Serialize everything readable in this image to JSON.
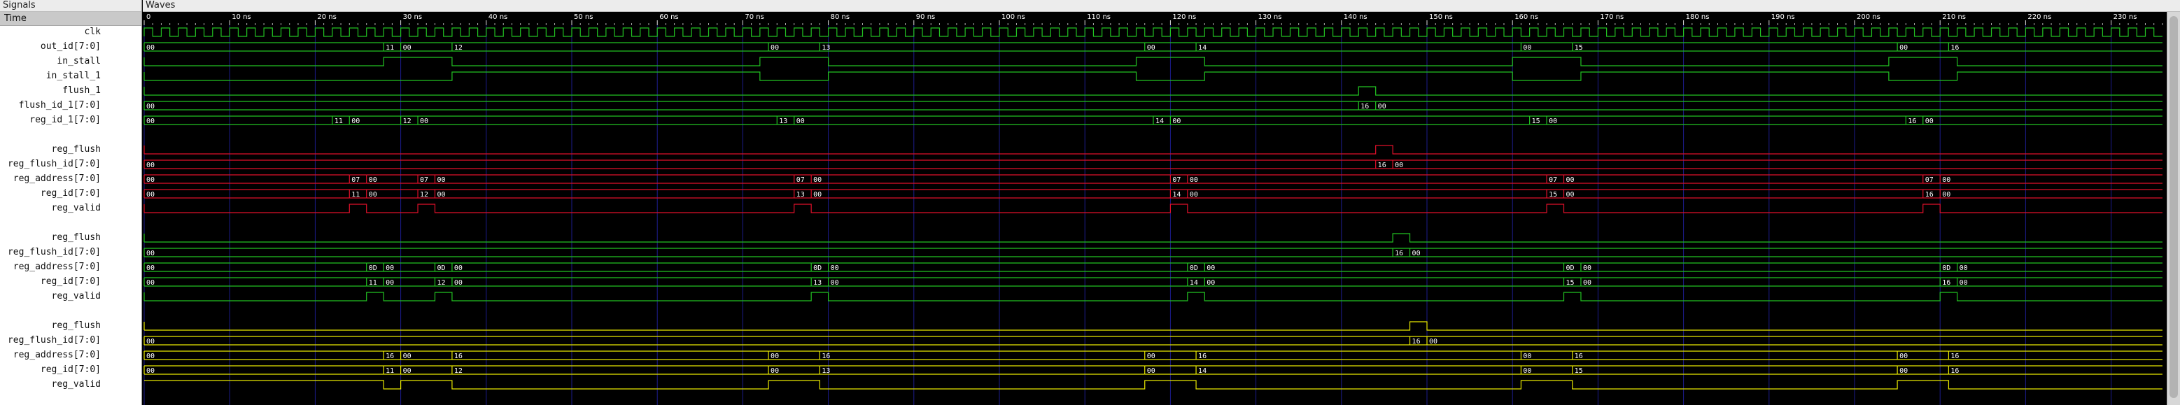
{
  "panes": {
    "signals_title": "Signals",
    "waves_title": "Waves"
  },
  "signal_header": "Time",
  "time_axis": {
    "unit": "ns",
    "min": 0,
    "max": 236,
    "ticks": [
      0,
      10,
      20,
      30,
      40,
      50,
      60,
      70,
      80,
      90,
      100,
      110,
      120,
      130,
      140,
      150,
      160,
      170,
      180,
      190,
      200,
      210,
      220,
      230
    ],
    "tick_labels": [
      "0",
      "10 ns",
      "20 ns",
      "30 ns",
      "40 ns",
      "50 ns",
      "60 ns",
      "70 ns",
      "80 ns",
      "90 ns",
      "100 ns",
      "110 ns",
      "120 ns",
      "130 ns",
      "140 ns",
      "150 ns",
      "160 ns",
      "170 ns",
      "180 ns",
      "190 ns",
      "200 ns",
      "210 ns",
      "220 ns",
      "230 ns"
    ]
  },
  "colors": {
    "green": "#22c322",
    "red": "#e0102a",
    "yellow": "#e8e800",
    "grid": "#1c1c8c",
    "text": "#ffffff",
    "clk": "#22c322"
  },
  "rows": [
    {
      "name": "clk",
      "kind": "clock",
      "color": "green",
      "period": 2
    },
    {
      "name": "out_id[7:0]",
      "kind": "bus",
      "color": "green",
      "segments": [
        [
          0,
          "00"
        ],
        [
          28,
          "11"
        ],
        [
          30,
          "00"
        ],
        [
          36,
          "12"
        ],
        [
          73,
          "00"
        ],
        [
          79,
          "13"
        ],
        [
          117,
          "00"
        ],
        [
          123,
          "14"
        ],
        [
          161,
          "00"
        ],
        [
          167,
          "15"
        ],
        [
          205,
          "00"
        ],
        [
          211,
          "16"
        ]
      ]
    },
    {
      "name": "in_stall",
      "kind": "bit",
      "color": "green",
      "initial": 0,
      "edges": [
        28,
        36,
        72,
        80,
        116,
        124,
        160,
        168,
        204,
        212
      ]
    },
    {
      "name": "in_stall_1",
      "kind": "bit",
      "color": "green",
      "initial": 0,
      "edges": [
        36,
        72,
        80,
        116,
        124,
        160,
        168,
        204,
        212
      ]
    },
    {
      "name": "flush_1",
      "kind": "bit",
      "color": "green",
      "initial": 0,
      "edges": [
        142,
        144
      ]
    },
    {
      "name": "flush_id_1[7:0]",
      "kind": "bus",
      "color": "green",
      "segments": [
        [
          0,
          "00"
        ],
        [
          142,
          "16"
        ],
        [
          144,
          "00"
        ]
      ]
    },
    {
      "name": "reg_id_1[7:0]",
      "kind": "bus",
      "color": "green",
      "segments": [
        [
          0,
          "00"
        ],
        [
          22,
          "11"
        ],
        [
          24,
          "00"
        ],
        [
          30,
          "12"
        ],
        [
          32,
          "00"
        ],
        [
          74,
          "13"
        ],
        [
          76,
          "00"
        ],
        [
          118,
          "14"
        ],
        [
          120,
          "00"
        ],
        [
          162,
          "15"
        ],
        [
          164,
          "00"
        ],
        [
          206,
          "16"
        ],
        [
          208,
          "00"
        ]
      ]
    },
    {
      "name": "",
      "kind": "blank"
    },
    {
      "name": "reg_flush",
      "kind": "bit",
      "color": "red",
      "initial": 0,
      "edges": [
        144,
        146
      ]
    },
    {
      "name": "reg_flush_id[7:0]",
      "kind": "bus",
      "color": "red",
      "segments": [
        [
          0,
          "00"
        ],
        [
          144,
          "16"
        ],
        [
          146,
          "00"
        ]
      ]
    },
    {
      "name": "reg_address[7:0]",
      "kind": "bus",
      "color": "red",
      "segments": [
        [
          0,
          "00"
        ],
        [
          24,
          "07"
        ],
        [
          26,
          "00"
        ],
        [
          32,
          "07"
        ],
        [
          34,
          "00"
        ],
        [
          76,
          "07"
        ],
        [
          78,
          "00"
        ],
        [
          120,
          "07"
        ],
        [
          122,
          "00"
        ],
        [
          164,
          "07"
        ],
        [
          166,
          "00"
        ],
        [
          208,
          "07"
        ],
        [
          210,
          "00"
        ]
      ]
    },
    {
      "name": "reg_id[7:0]",
      "kind": "bus",
      "color": "red",
      "segments": [
        [
          0,
          "00"
        ],
        [
          24,
          "11"
        ],
        [
          26,
          "00"
        ],
        [
          32,
          "12"
        ],
        [
          34,
          "00"
        ],
        [
          76,
          "13"
        ],
        [
          78,
          "00"
        ],
        [
          120,
          "14"
        ],
        [
          122,
          "00"
        ],
        [
          164,
          "15"
        ],
        [
          166,
          "00"
        ],
        [
          208,
          "16"
        ],
        [
          210,
          "00"
        ]
      ]
    },
    {
      "name": "reg_valid",
      "kind": "bit",
      "color": "red",
      "initial": 0,
      "edges": [
        24,
        26,
        32,
        34,
        76,
        78,
        120,
        122,
        164,
        166,
        208,
        210
      ]
    },
    {
      "name": "",
      "kind": "blank"
    },
    {
      "name": "reg_flush",
      "kind": "bit",
      "color": "green",
      "initial": 0,
      "edges": [
        146,
        148
      ]
    },
    {
      "name": "reg_flush_id[7:0]",
      "kind": "bus",
      "color": "green",
      "segments": [
        [
          0,
          "00"
        ],
        [
          146,
          "16"
        ],
        [
          148,
          "00"
        ]
      ]
    },
    {
      "name": "reg_address[7:0]",
      "kind": "bus",
      "color": "green",
      "segments": [
        [
          0,
          "00"
        ],
        [
          26,
          "0D"
        ],
        [
          28,
          "00"
        ],
        [
          34,
          "0D"
        ],
        [
          36,
          "00"
        ],
        [
          78,
          "0D"
        ],
        [
          80,
          "00"
        ],
        [
          122,
          "0D"
        ],
        [
          124,
          "00"
        ],
        [
          166,
          "0D"
        ],
        [
          168,
          "00"
        ],
        [
          210,
          "0D"
        ],
        [
          212,
          "00"
        ]
      ]
    },
    {
      "name": "reg_id[7:0]",
      "kind": "bus",
      "color": "green",
      "segments": [
        [
          0,
          "00"
        ],
        [
          26,
          "11"
        ],
        [
          28,
          "00"
        ],
        [
          34,
          "12"
        ],
        [
          36,
          "00"
        ],
        [
          78,
          "13"
        ],
        [
          80,
          "00"
        ],
        [
          122,
          "14"
        ],
        [
          124,
          "00"
        ],
        [
          166,
          "15"
        ],
        [
          168,
          "00"
        ],
        [
          210,
          "16"
        ],
        [
          212,
          "00"
        ]
      ]
    },
    {
      "name": "reg_valid",
      "kind": "bit",
      "color": "green",
      "initial": 0,
      "edges": [
        26,
        28,
        34,
        36,
        78,
        80,
        122,
        124,
        166,
        168,
        210,
        212
      ]
    },
    {
      "name": "",
      "kind": "blank"
    },
    {
      "name": "reg_flush",
      "kind": "bit",
      "color": "yellow",
      "initial": 0,
      "edges": [
        148,
        150
      ]
    },
    {
      "name": "reg_flush_id[7:0]",
      "kind": "bus",
      "color": "yellow",
      "segments": [
        [
          0,
          "00"
        ],
        [
          148,
          "16"
        ],
        [
          150,
          "00"
        ]
      ]
    },
    {
      "name": "reg_address[7:0]",
      "kind": "bus",
      "color": "yellow",
      "segments": [
        [
          0,
          "00"
        ],
        [
          28,
          "16"
        ],
        [
          30,
          "00"
        ],
        [
          36,
          "16"
        ],
        [
          73,
          "00"
        ],
        [
          79,
          "16"
        ],
        [
          117,
          "00"
        ],
        [
          123,
          "16"
        ],
        [
          161,
          "00"
        ],
        [
          167,
          "16"
        ],
        [
          205,
          "00"
        ],
        [
          211,
          "16"
        ]
      ]
    },
    {
      "name": "reg_id[7:0]",
      "kind": "bus",
      "color": "yellow",
      "segments": [
        [
          0,
          "00"
        ],
        [
          28,
          "11"
        ],
        [
          30,
          "00"
        ],
        [
          36,
          "12"
        ],
        [
          73,
          "00"
        ],
        [
          79,
          "13"
        ],
        [
          117,
          "00"
        ],
        [
          123,
          "14"
        ],
        [
          161,
          "00"
        ],
        [
          167,
          "15"
        ],
        [
          205,
          "00"
        ],
        [
          211,
          "16"
        ]
      ]
    },
    {
      "name": "reg_valid",
      "kind": "bit",
      "color": "yellow",
      "initial": 1,
      "edges": [
        28,
        30,
        36,
        73,
        79,
        117,
        123,
        161,
        167,
        205,
        211
      ]
    }
  ]
}
